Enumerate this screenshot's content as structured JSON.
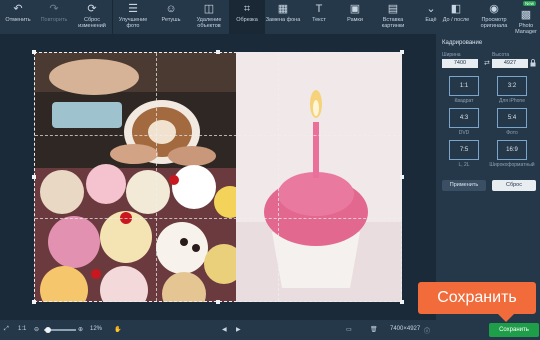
{
  "toolbar": {
    "undo": "Отменить",
    "redo": "Повторить",
    "reset": "Сброс изменений",
    "enhance": "Улучшение фото",
    "retouch": "Ретушь",
    "remove_objects": "Удаление объектов",
    "crop": "Обрезка",
    "replace_bg": "Замена фона",
    "text": "Текст",
    "frames": "Рамки",
    "insert_image": "Вставка картинки",
    "more": "Ещё",
    "before_after": "До / после",
    "view_original": "Просмотр оригинала",
    "photo_manager": "Photo Manager",
    "new_badge": "New"
  },
  "panel": {
    "title": "Кадрирование",
    "width_label": "Ширина",
    "height_label": "Высота",
    "width_value": "7400",
    "height_value": "4927",
    "ratios": [
      {
        "value": "1:1",
        "label": "Квадрат"
      },
      {
        "value": "3:2",
        "label": "Для iPhone"
      },
      {
        "value": "4:3",
        "label": "DVD"
      },
      {
        "value": "5:4",
        "label": "Фото"
      },
      {
        "value": "7:5",
        "label": "L, 2L"
      },
      {
        "value": "16:9",
        "label": "Широкоформатный"
      }
    ],
    "apply": "Применить",
    "reset": "Сброс"
  },
  "status": {
    "zoom_fit": "1:1",
    "zoom_percent": "12%",
    "dimensions": "7400×4927",
    "save": "Сохранить"
  },
  "callout": "Сохранить",
  "colors": {
    "accent_green": "#1f9e49",
    "callout_orange": "#f26b3b",
    "toolbar_bg": "#25384a"
  }
}
